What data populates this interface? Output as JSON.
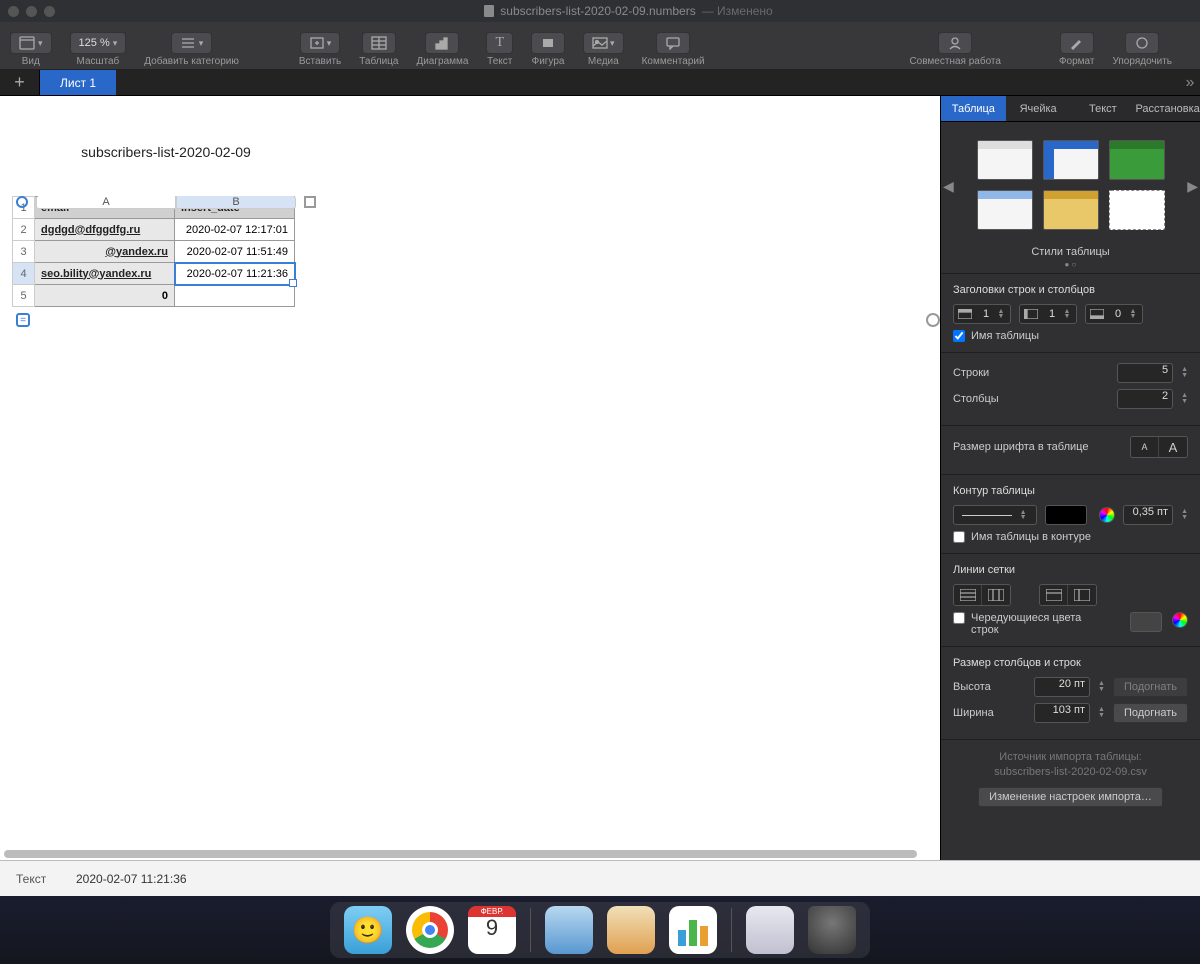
{
  "window": {
    "filename": "subscribers-list-2020-02-09.numbers",
    "modified": "— Изменено"
  },
  "toolbar": {
    "view": "Вид",
    "zoom_value": "125 %",
    "zoom_label": "Масштаб",
    "add_category": "Добавить категорию",
    "insert": "Вставить",
    "table": "Таблица",
    "chart": "Диаграмма",
    "text": "Текст",
    "shape": "Фигура",
    "media": "Медиа",
    "comment": "Комментарий",
    "collab": "Совместная работа",
    "format": "Формат",
    "arrange": "Упорядочить"
  },
  "sheets": {
    "tab1": "Лист 1"
  },
  "table": {
    "title": "subscribers-list-2020-02-09",
    "columns": [
      "A",
      "B"
    ],
    "headers": {
      "col1": "email",
      "col2": "insert_date"
    },
    "rows": [
      {
        "n": "1"
      },
      {
        "n": "2",
        "email": "dgdgd@dfggdfg.ru",
        "date": "2020-02-07 12:17:01"
      },
      {
        "n": "3",
        "email": "@yandex.ru",
        "date": "2020-02-07 11:51:49"
      },
      {
        "n": "4",
        "email": "seo.bility@yandex.ru",
        "date": "2020-02-07 11:21:36"
      },
      {
        "n": "5",
        "email": "0",
        "date": ""
      }
    ]
  },
  "statusbar": {
    "label": "Текст",
    "value": "2020-02-07 11:21:36"
  },
  "inspector": {
    "tabs": {
      "table": "Таблица",
      "cell": "Ячейка",
      "text": "Текст",
      "placement": "Расстановка"
    },
    "styles_label": "Стили таблицы",
    "headers_section": "Заголовки строк и столбцов",
    "header_rows": "1",
    "header_cols": "1",
    "footer_rows": "0",
    "table_name_ck": "Имя таблицы",
    "rows_label": "Строки",
    "rows_val": "5",
    "cols_label": "Столбцы",
    "cols_val": "2",
    "font_size_label": "Размер шрифта в таблице",
    "outline_label": "Контур таблицы",
    "outline_weight": "0,35 пт",
    "name_in_outline": "Имя таблицы в контуре",
    "grid_label": "Линии сетки",
    "alt_rows": "Чередующиеся цвета строк",
    "size_section": "Размер столбцов и строк",
    "height_label": "Высота",
    "height_val": "20 пт",
    "width_label": "Ширина",
    "width_val": "103 пт",
    "fit": "Подогнать",
    "import_line1": "Источник импорта таблицы:",
    "import_line2": "subscribers-list-2020-02-09.csv",
    "import_btn": "Изменение настроек импорта…"
  },
  "dock": {
    "cal_month": "ФЕВР.",
    "cal_day": "9"
  }
}
